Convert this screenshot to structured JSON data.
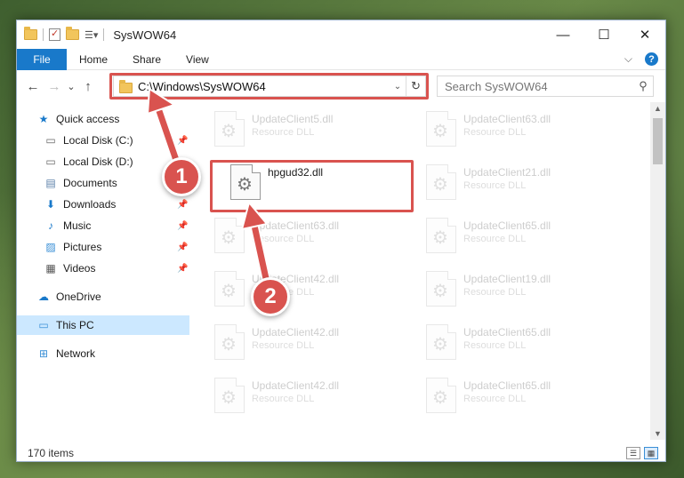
{
  "window": {
    "title": "SysWOW64",
    "controls": {
      "minimize": "—",
      "maximize": "☐",
      "close": "✕"
    }
  },
  "ribbon": {
    "tabs": [
      "File",
      "Home",
      "Share",
      "View"
    ],
    "collapse_glyph": "⌵",
    "help_glyph": "?"
  },
  "nav": {
    "back": "←",
    "forward": "→",
    "recent": "⌄",
    "up": "↑"
  },
  "address": {
    "path": "C:\\Windows\\SysWOW64",
    "dropdown_glyph": "⌄",
    "refresh_glyph": "↻"
  },
  "search": {
    "placeholder": "Search SysWOW64",
    "icon_glyph": "⚲"
  },
  "sidebar": {
    "items": [
      {
        "label": "Quick access",
        "icon": "star-icon"
      },
      {
        "label": "Local Disk (C:)",
        "icon": "drive-icon",
        "pinned": true
      },
      {
        "label": "Local Disk (D:)",
        "icon": "drive-icon"
      },
      {
        "label": "Documents",
        "icon": "document-icon"
      },
      {
        "label": "Downloads",
        "icon": "download-icon",
        "pinned": true
      },
      {
        "label": "Music",
        "icon": "music-icon",
        "pinned": true
      },
      {
        "label": "Pictures",
        "icon": "picture-icon",
        "pinned": true
      },
      {
        "label": "Videos",
        "icon": "video-icon",
        "pinned": true
      },
      {
        "label": "OneDrive",
        "icon": "cloud-icon"
      },
      {
        "label": "This PC",
        "icon": "computer-icon",
        "selected": true
      },
      {
        "label": "Network",
        "icon": "network-icon"
      }
    ],
    "pin_glyph": "📌"
  },
  "files": [
    {
      "name": "UpdateClient5.dll",
      "type": "Resource DLL"
    },
    {
      "name": "UpdateClient63.dll",
      "type": "Resource DLL"
    },
    {
      "name": "hpgud32.dll",
      "type": "",
      "selected": true
    },
    {
      "name": "UpdateClient21.dll",
      "type": "Resource DLL"
    },
    {
      "name": "UpdateClient63.dll",
      "type": "Resource DLL"
    },
    {
      "name": "UpdateClient65.dll",
      "type": "Resource DLL"
    },
    {
      "name": "UpdateClient42.dll",
      "type": "Resource DLL"
    },
    {
      "name": "UpdateClient19.dll",
      "type": "Resource DLL"
    },
    {
      "name": "UpdateClient42.dll",
      "type": "Resource DLL"
    },
    {
      "name": "UpdateClient65.dll",
      "type": "Resource DLL"
    },
    {
      "name": "UpdateClient42.dll",
      "type": "Resource DLL"
    },
    {
      "name": "UpdateClient65.dll",
      "type": "Resource DLL"
    }
  ],
  "status": {
    "item_count": "170 items"
  },
  "annotations": [
    {
      "number": "1"
    },
    {
      "number": "2"
    }
  ],
  "colors": {
    "accent": "#1979ca",
    "callout": "#d9534f",
    "selected_nav": "#cce8ff"
  }
}
